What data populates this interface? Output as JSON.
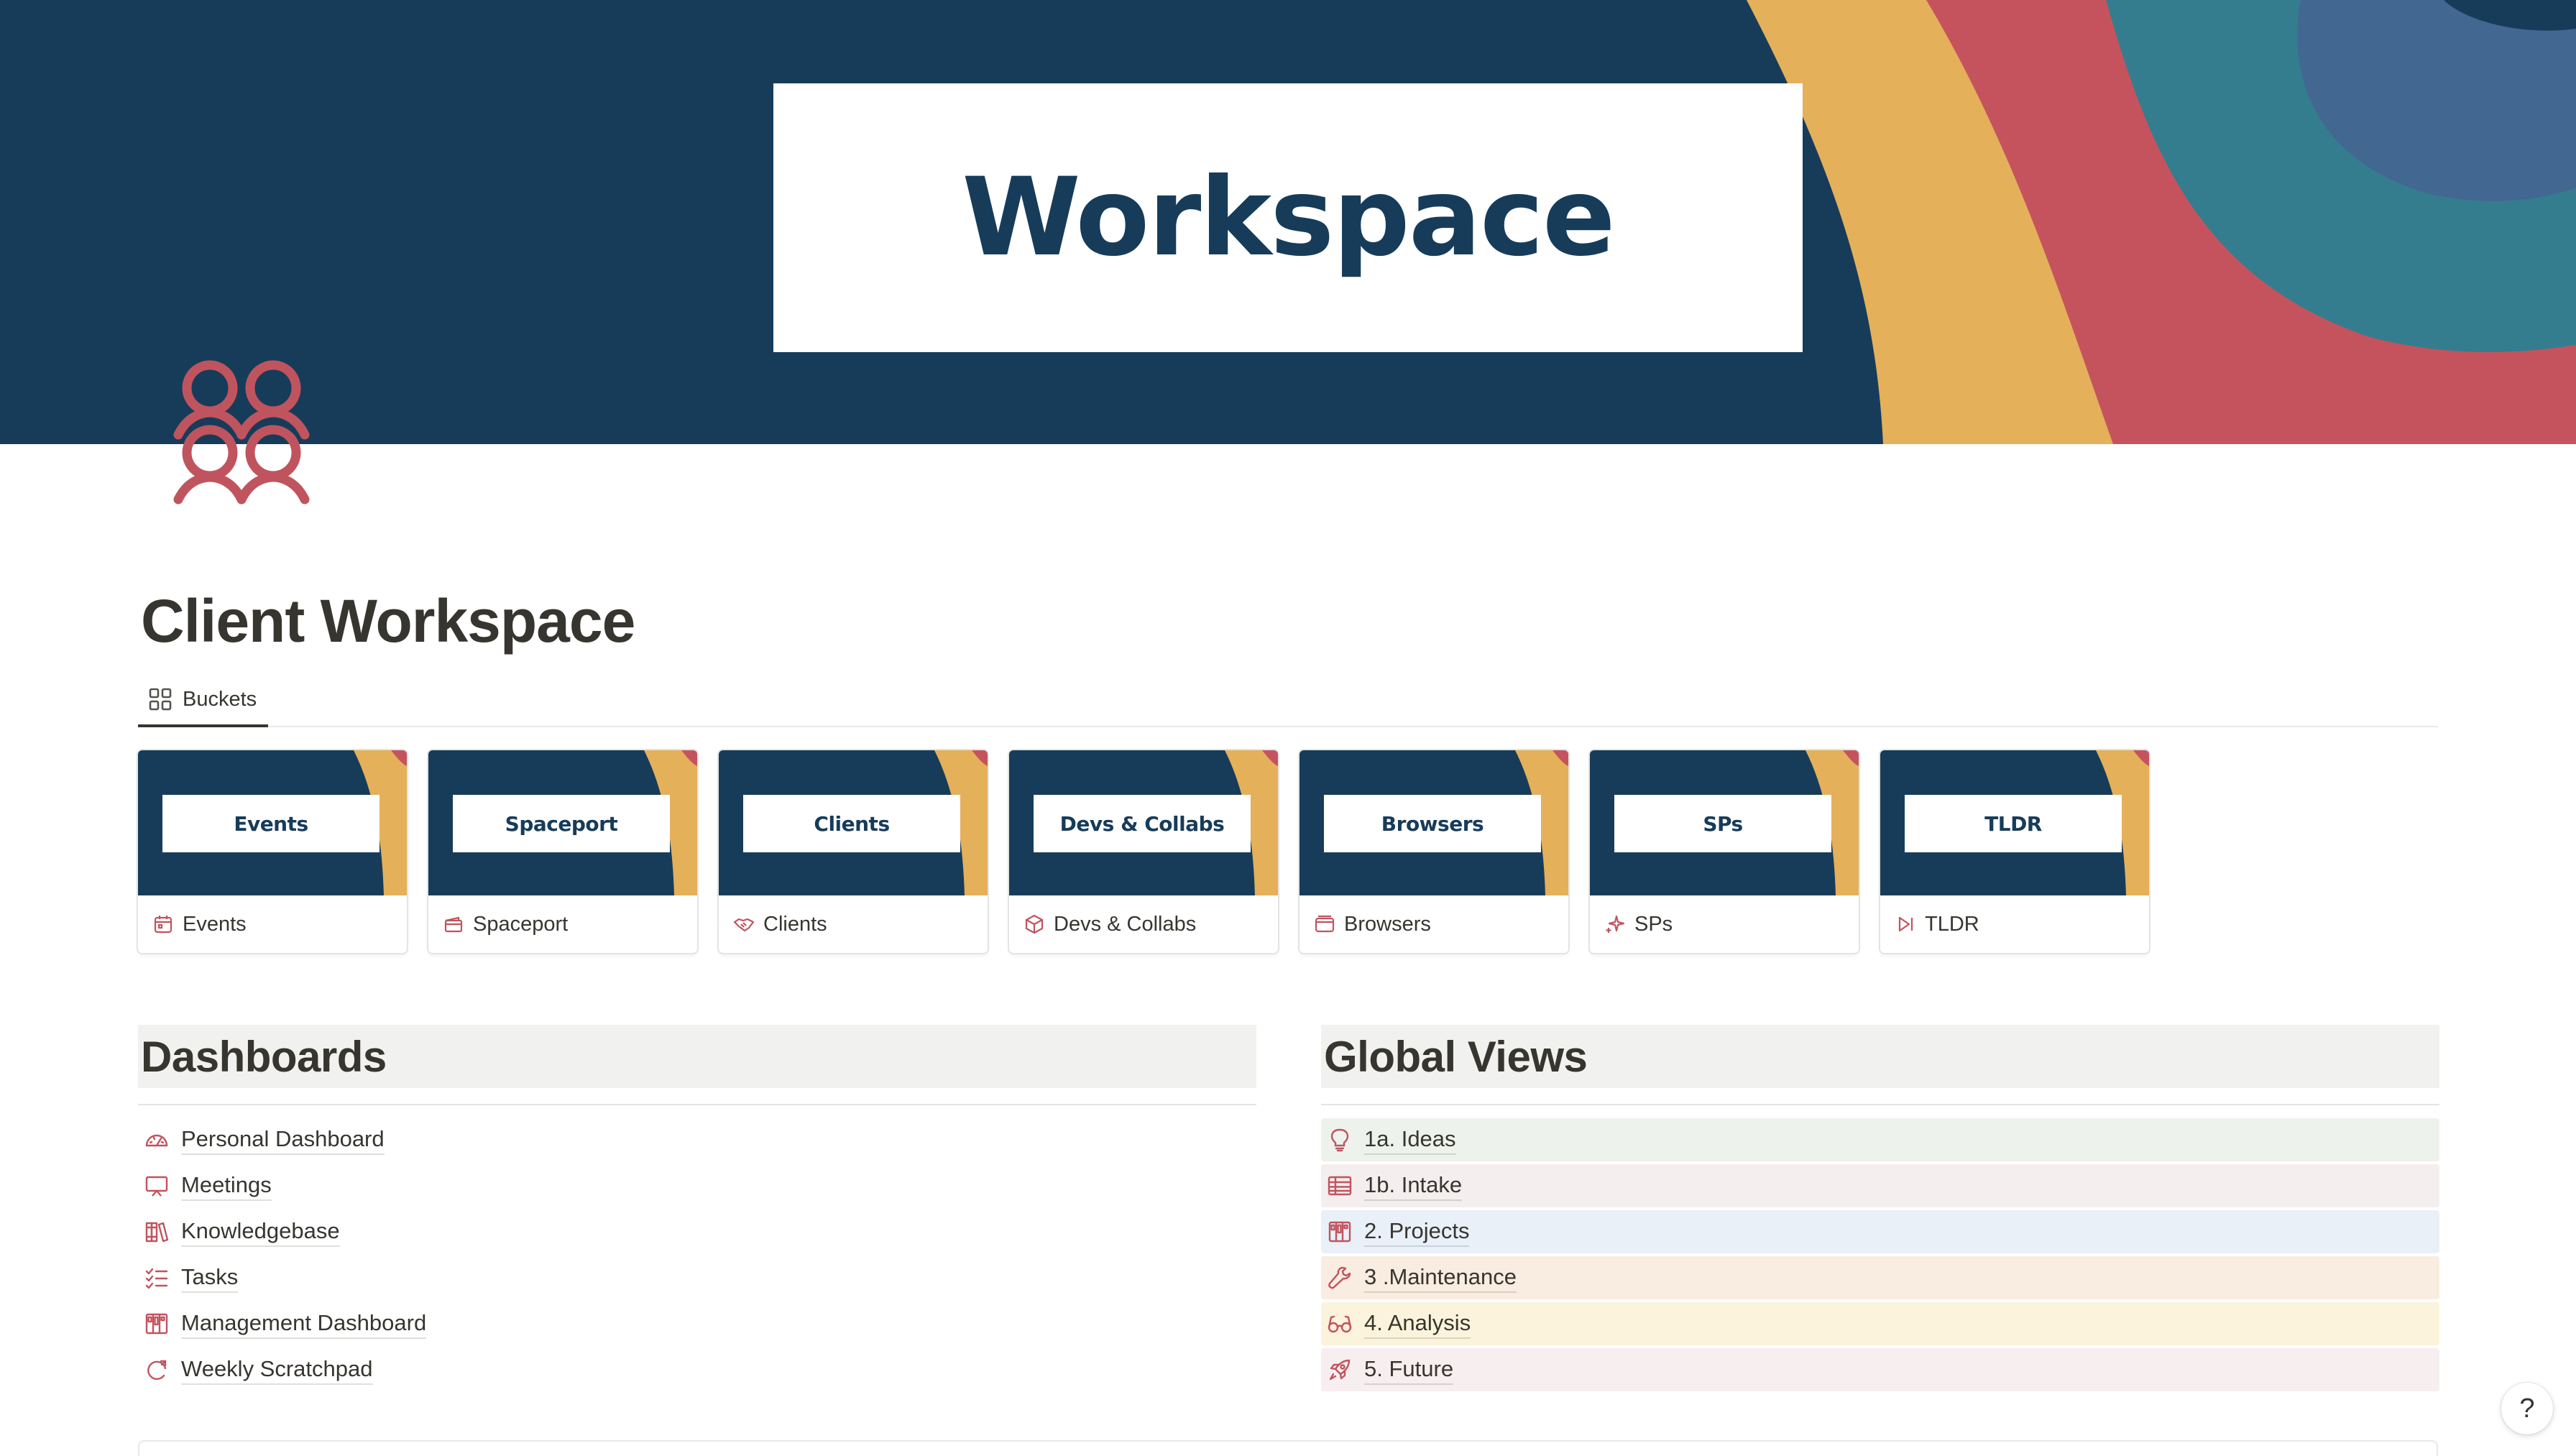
{
  "cover": {
    "text": "Workspace"
  },
  "colors": {
    "navy": "#173c5a",
    "yellow": "#e4b05a",
    "red": "#c5535e",
    "teal": "#347d8e",
    "blue": "#426891",
    "accent": "#c0545e"
  },
  "page": {
    "title": "Client Workspace",
    "icon": "people-group-icon"
  },
  "view_tab": {
    "label": "Buckets",
    "icon": "gallery-grid-icon"
  },
  "gallery": [
    {
      "cover_text": "Events",
      "label": "Events",
      "icon": "calendar-icon"
    },
    {
      "cover_text": "Spaceport",
      "label": "Spaceport",
      "icon": "wallet-icon"
    },
    {
      "cover_text": "Clients",
      "label": "Clients",
      "icon": "handshake-icon"
    },
    {
      "cover_text": "Devs & Collabs",
      "label": "Devs & Collabs",
      "icon": "cube-icon"
    },
    {
      "cover_text": "Browsers",
      "label": "Browsers",
      "icon": "browser-window-icon"
    },
    {
      "cover_text": "SPs",
      "label": "SPs",
      "icon": "sparkle-icon"
    },
    {
      "cover_text": "TLDR",
      "label": "TLDR",
      "icon": "skip-forward-icon"
    }
  ],
  "dashboards": {
    "title": "Dashboards",
    "items": [
      {
        "label": "Personal Dashboard",
        "icon": "gauge-icon"
      },
      {
        "label": "Meetings",
        "icon": "presentation-icon"
      },
      {
        "label": "Knowledgebase",
        "icon": "books-icon"
      },
      {
        "label": "Tasks",
        "icon": "checklist-icon"
      },
      {
        "label": "Management Dashboard",
        "icon": "board-icon"
      },
      {
        "label": "Weekly Scratchpad",
        "icon": "refresh-icon"
      }
    ]
  },
  "global_views": {
    "title": "Global Views",
    "items": [
      {
        "label": "1a. Ideas",
        "icon": "lightbulb-icon",
        "bg": "#edf3ec"
      },
      {
        "label": "1b. Intake",
        "icon": "table-icon",
        "bg": "#f4eeee"
      },
      {
        "label": "2. Projects",
        "icon": "board-icon",
        "bg": "#e9f0f8"
      },
      {
        "label": "3 .Maintenance",
        "icon": "wrench-icon",
        "bg": "#f9ece0"
      },
      {
        "label": "4. Analysis",
        "icon": "glasses-icon",
        "bg": "#fbf3db"
      },
      {
        "label": "5. Future",
        "icon": "rocket-icon",
        "bg": "#f7eef0"
      }
    ]
  },
  "help": {
    "label": "?"
  }
}
